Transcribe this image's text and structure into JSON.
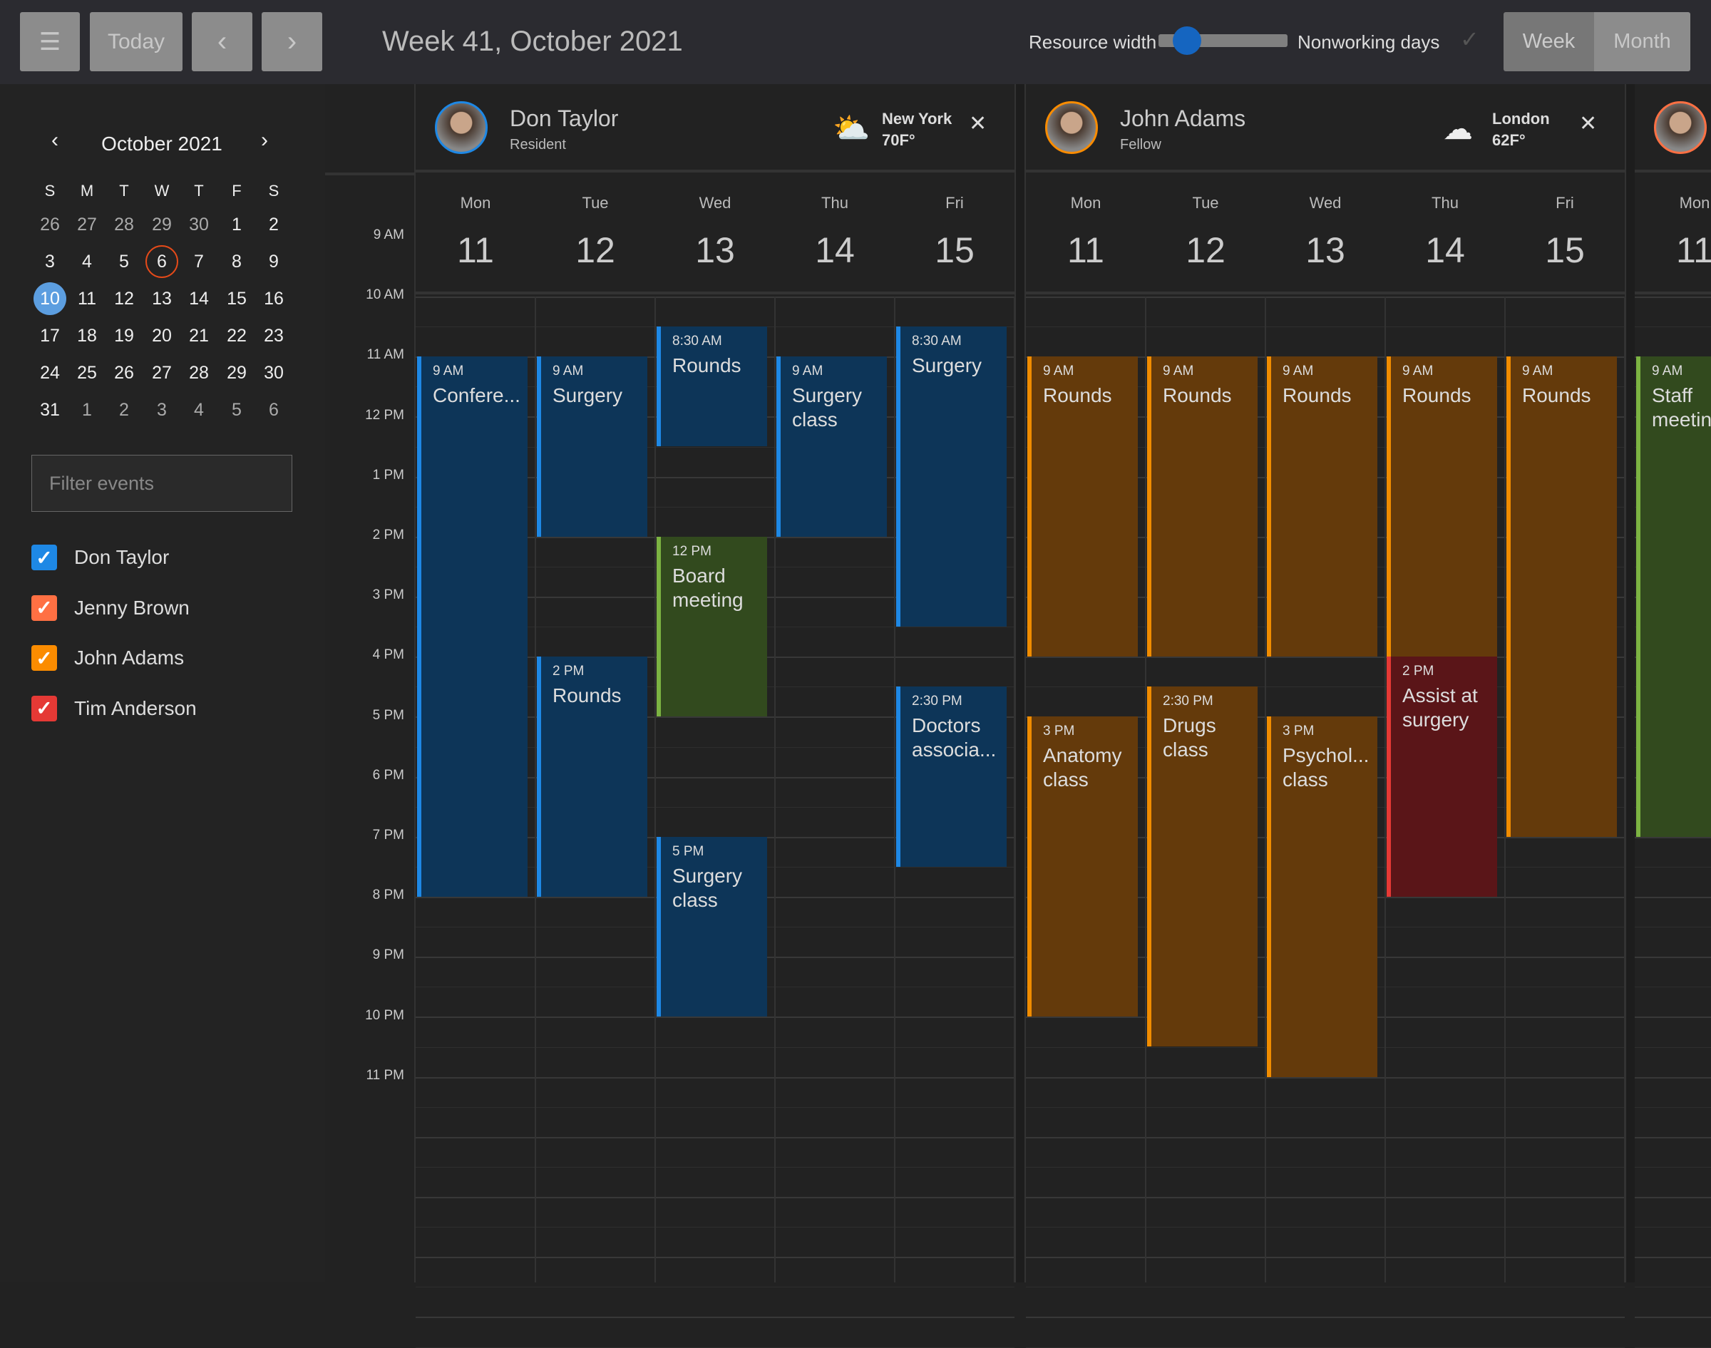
{
  "toolbar": {
    "menu_icon": "hamburger-icon",
    "today": "Today",
    "prev": "‹",
    "next": "›",
    "title": "Week 41, October 2021",
    "resource_width_label": "Resource width",
    "resource_width_value": 0.2,
    "nonworking_label": "Nonworking days",
    "views": [
      "Week",
      "Month"
    ],
    "active_view": "Week"
  },
  "mini_calendar": {
    "title": "October  2021",
    "prev": "‹",
    "next": "›",
    "weekdays": [
      "S",
      "M",
      "T",
      "W",
      "T",
      "F",
      "S"
    ],
    "weeks": [
      [
        "26",
        "27",
        "28",
        "29",
        "30",
        "1",
        "2"
      ],
      [
        "3",
        "4",
        "5",
        "6",
        "7",
        "8",
        "9"
      ],
      [
        "10",
        "11",
        "12",
        "13",
        "14",
        "15",
        "16"
      ],
      [
        "17",
        "18",
        "19",
        "20",
        "21",
        "22",
        "23"
      ],
      [
        "24",
        "25",
        "26",
        "27",
        "28",
        "29",
        "30"
      ],
      [
        "31",
        "1",
        "2",
        "3",
        "4",
        "5",
        "6"
      ]
    ],
    "today": "6",
    "selected": "10"
  },
  "filter": {
    "placeholder": "Filter events"
  },
  "resource_filters": [
    {
      "label": "Don Taylor",
      "color": "#1e88e5"
    },
    {
      "label": "Jenny Brown",
      "color": "#ff7043"
    },
    {
      "label": "John Adams",
      "color": "#fb8c00"
    },
    {
      "label": "Tim Anderson",
      "color": "#e53935"
    }
  ],
  "time_labels": [
    "9 AM",
    "10 AM",
    "11 AM",
    "12 PM",
    "1 PM",
    "2 PM",
    "3 PM",
    "4 PM",
    "5 PM",
    "6 PM",
    "7 PM",
    "8 PM",
    "9 PM",
    "10 PM",
    "11 PM"
  ],
  "colors": {
    "blue": [
      "#0d3558",
      "#1e88e5"
    ],
    "orange": [
      "#643a0b",
      "#f08c00"
    ],
    "green": [
      "#324a1e",
      "#7cb342"
    ],
    "red": [
      "#5a1518",
      "#e53935"
    ]
  },
  "resources": [
    {
      "name": "Don Taylor",
      "role": "Resident",
      "city": "New York",
      "temp": "70F°",
      "weather": "partly-cloudy-icon",
      "ring": "#1e88e5",
      "days": [
        {
          "n": "Mon",
          "d": "11"
        },
        {
          "n": "Tue",
          "d": "12"
        },
        {
          "n": "Wed",
          "d": "13"
        },
        {
          "n": "Thu",
          "d": "14"
        },
        {
          "n": "Fri",
          "d": "15"
        }
      ],
      "events": [
        {
          "day": 0,
          "start": 9,
          "end": 18,
          "time": "9 AM",
          "title": "Confere...",
          "color": "blue"
        },
        {
          "day": 1,
          "start": 9,
          "end": 12,
          "time": "9 AM",
          "title": "Surgery",
          "color": "blue"
        },
        {
          "day": 1,
          "start": 14,
          "end": 18,
          "time": "2 PM",
          "title": "Rounds",
          "color": "blue"
        },
        {
          "day": 2,
          "start": 8.5,
          "end": 10.5,
          "time": "8:30 AM",
          "title": "Rounds",
          "color": "blue"
        },
        {
          "day": 2,
          "start": 12,
          "end": 15,
          "time": "12 PM",
          "title": "Board meeting",
          "color": "green"
        },
        {
          "day": 2,
          "start": 17,
          "end": 20,
          "time": "5 PM",
          "title": "Surgery class",
          "color": "blue"
        },
        {
          "day": 3,
          "start": 9,
          "end": 12,
          "time": "9 AM",
          "title": "Surgery class",
          "color": "blue"
        },
        {
          "day": 4,
          "start": 8.5,
          "end": 13.5,
          "time": "8:30 AM",
          "title": "Surgery",
          "color": "blue"
        },
        {
          "day": 4,
          "start": 14.5,
          "end": 17.5,
          "time": "2:30 PM",
          "title": "Doctors associa...",
          "color": "blue"
        }
      ]
    },
    {
      "name": "John Adams",
      "role": "Fellow",
      "city": "London",
      "temp": "62F°",
      "weather": "snow-cloud-icon",
      "ring": "#fb8c00",
      "days": [
        {
          "n": "Mon",
          "d": "11"
        },
        {
          "n": "Tue",
          "d": "12"
        },
        {
          "n": "Wed",
          "d": "13"
        },
        {
          "n": "Thu",
          "d": "14"
        },
        {
          "n": "Fri",
          "d": "15"
        }
      ],
      "events": [
        {
          "day": 0,
          "start": 9,
          "end": 14,
          "time": "9 AM",
          "title": "Rounds",
          "color": "orange"
        },
        {
          "day": 0,
          "start": 15,
          "end": 20,
          "time": "3 PM",
          "title": "Anatomy class",
          "color": "orange"
        },
        {
          "day": 1,
          "start": 9,
          "end": 14,
          "time": "9 AM",
          "title": "Rounds",
          "color": "orange"
        },
        {
          "day": 1,
          "start": 14.5,
          "end": 20.5,
          "time": "2:30 PM",
          "title": "Drugs class",
          "color": "orange"
        },
        {
          "day": 2,
          "start": 9,
          "end": 14,
          "time": "9 AM",
          "title": "Rounds",
          "color": "orange"
        },
        {
          "day": 2,
          "start": 15,
          "end": 21,
          "time": "3 PM",
          "title": "Psychol... class",
          "color": "orange"
        },
        {
          "day": 3,
          "start": 9,
          "end": 14,
          "time": "9 AM",
          "title": "Rounds",
          "color": "orange"
        },
        {
          "day": 3,
          "start": 14,
          "end": 18,
          "time": "2 PM",
          "title": "Assist at surgery",
          "color": "red"
        },
        {
          "day": 4,
          "start": 9,
          "end": 17,
          "time": "9 AM",
          "title": "Rounds",
          "color": "orange"
        }
      ]
    },
    {
      "name": "",
      "role": "",
      "city": "",
      "temp": "",
      "weather": "",
      "ring": "#ff7043",
      "days": [
        {
          "n": "Mon",
          "d": "11"
        }
      ],
      "events": [
        {
          "day": 0,
          "start": 9,
          "end": 17,
          "time": "9 AM",
          "title": "Staff meetin",
          "color": "green"
        }
      ]
    }
  ]
}
